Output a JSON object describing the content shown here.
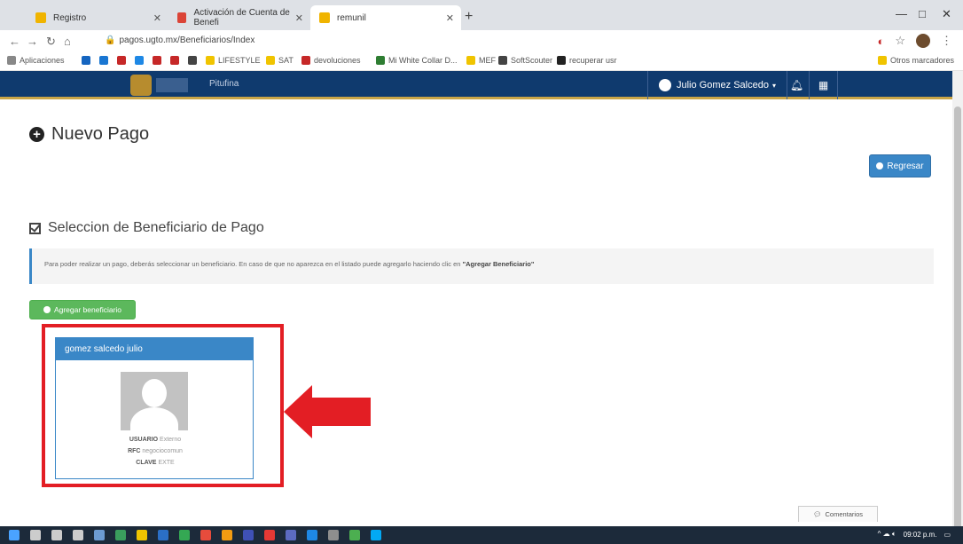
{
  "browser": {
    "tabs": [
      {
        "label": "Registro",
        "color": "#f0b400"
      },
      {
        "label": "Activación de Cuenta de Benefi",
        "color": "#db4437"
      },
      {
        "label": "remunil",
        "color": "#f0b400"
      }
    ],
    "url": "pagos.ugto.mx/Beneficiarios/Index",
    "bookmarks": [
      {
        "label": "Aplicaciones",
        "color": "#888"
      },
      {
        "label": "",
        "color": "#1565c0"
      },
      {
        "label": "",
        "color": "#1976d2"
      },
      {
        "label": "",
        "color": "#c62828"
      },
      {
        "label": "",
        "color": "#1e88e5"
      },
      {
        "label": "",
        "color": "#c62828"
      },
      {
        "label": "",
        "color": "#c62828"
      },
      {
        "label": "",
        "color": "#444"
      },
      {
        "label": "LIFESTYLE",
        "color": "#f0c400"
      },
      {
        "label": "SAT",
        "color": "#f0c400"
      },
      {
        "label": "devoluciones",
        "color": "#c62828"
      },
      {
        "label": "Mi White Collar D...",
        "color": "#2e7d32"
      },
      {
        "label": "MEF",
        "color": "#f0c400"
      },
      {
        "label": "SoftScouter",
        "color": "#444"
      },
      {
        "label": "recuperar usr",
        "color": "#222"
      }
    ],
    "other_bookmarks": "Otros marcadores"
  },
  "appnav": {
    "brand": "Pitufina",
    "user": "Julio Gomez Salcedo"
  },
  "page": {
    "title": "Nuevo Pago",
    "back_button": "Regresar",
    "section_title": "Seleccion de Beneficiario de Pago",
    "info_text": "Para poder realizar un pago, deberás seleccionar un beneficiario. En caso de que no aparezca en el listado puede agregarlo haciendo clic en ",
    "info_bold": "\"Agregar Beneficiario\"",
    "add_button": "Agregar beneficiario"
  },
  "card": {
    "name": "gomez salcedo julio",
    "usuario_label": "USUARIO",
    "usuario_value": "Externo",
    "rfc_label": "RFC",
    "rfc_value": "negociocomun",
    "clave_label": "CLAVE",
    "clave_value": "EXTE"
  },
  "comments": "Comentarios",
  "taskbar": {
    "time": "09:02 p.m."
  }
}
